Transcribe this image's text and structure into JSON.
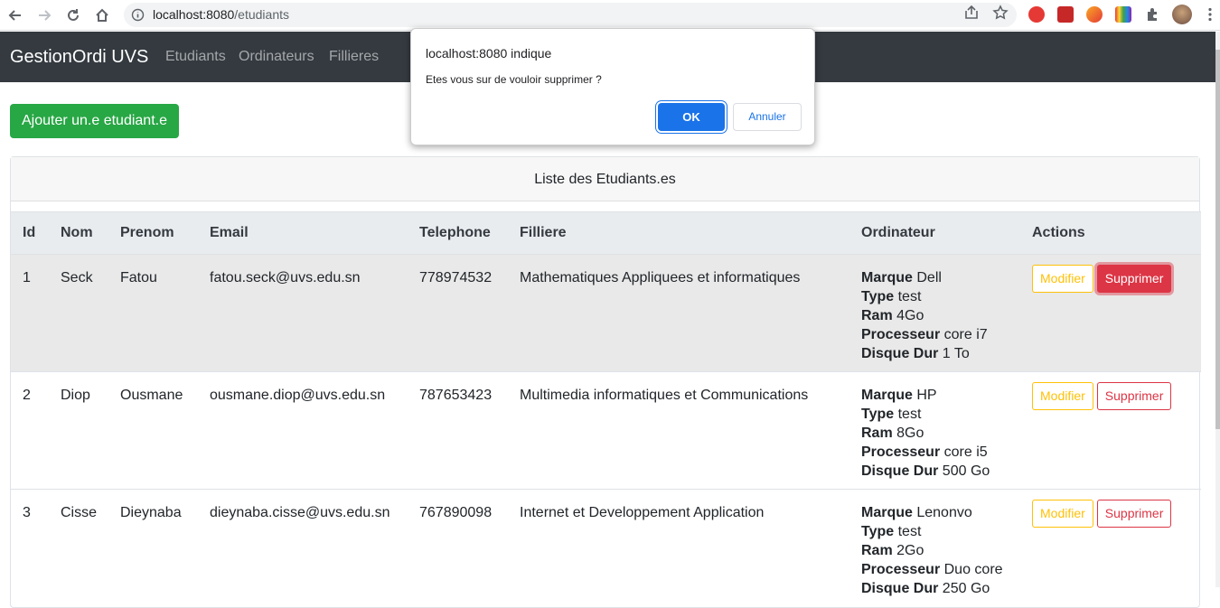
{
  "browser": {
    "url_host": "localhost:8080",
    "url_path": "/etudiants"
  },
  "navbar": {
    "brand": "GestionOrdi UVS",
    "links": [
      "Etudiants",
      "Ordinateurs",
      "Fillieres"
    ]
  },
  "add_button": "Ajouter un.e etudiant.e",
  "card_title": "Liste des Etudiants.es",
  "table": {
    "headers": [
      "Id",
      "Nom",
      "Prenom",
      "Email",
      "Telephone",
      "Filliere",
      "Ordinateur",
      "Actions"
    ],
    "computer_labels": {
      "marque": "Marque",
      "type": "Type",
      "ram": "Ram",
      "processeur": "Processeur",
      "disque": "Disque Dur"
    },
    "rows": [
      {
        "id": "1",
        "nom": "Seck",
        "prenom": "Fatou",
        "email": "fatou.seck@uvs.edu.sn",
        "telephone": "778974532",
        "filliere": "Mathematiques Appliquees et informatiques",
        "marque": "Dell",
        "type": "test",
        "ram": "4Go",
        "processeur": "core i7",
        "disque": "1 To"
      },
      {
        "id": "2",
        "nom": "Diop",
        "prenom": "Ousmane",
        "email": "ousmane.diop@uvs.edu.sn",
        "telephone": "787653423",
        "filliere": "Multimedia informatiques et Communications",
        "marque": "HP",
        "type": "test",
        "ram": "8Go",
        "processeur": "core i5",
        "disque": "500 Go"
      },
      {
        "id": "3",
        "nom": "Cisse",
        "prenom": "Dieynaba",
        "email": "dieynaba.cisse@uvs.edu.sn",
        "telephone": "767890098",
        "filliere": "Internet et Developpement Application",
        "marque": "Lenonvo",
        "type": "test",
        "ram": "2Go",
        "processeur": "Duo core",
        "disque": "250 Go"
      }
    ],
    "modify_label": "Modifier",
    "delete_label": "Supprimer"
  },
  "dialog": {
    "origin": "localhost:8080 indique",
    "message": "Etes vous sur de vouloir supprimer ?",
    "ok_label": "OK",
    "cancel_label": "Annuler"
  },
  "colors": {
    "navbar_bg": "#343a40",
    "success": "#28a745",
    "warning": "#ffc107",
    "danger": "#dc3545",
    "chrome_blue": "#1a73e8"
  }
}
